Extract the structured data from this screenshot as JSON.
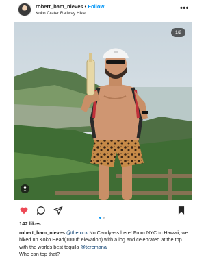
{
  "post": {
    "username": "robert_bam_nieves",
    "separator": "•",
    "follow_label": "Follow",
    "location": "Koko Crater Railway Hike",
    "more_icon": "more-icon",
    "more_glyph": "•••",
    "image_counter": "1/2",
    "likes": "142 likes",
    "caption": {
      "username": "robert_bam_nieves",
      "mention1": "@therock",
      "text1": " No Candyass here! From NYC to Hawaii, we hiked up Koko Head(1000ft elevation) with a log and celebrated  at the top with the worlds best tequila ",
      "mention2": "@teremana",
      "text2": "Who can top that?"
    }
  },
  "icons": {
    "like": "heart-icon",
    "comment": "comment-icon",
    "share": "share-icon",
    "save": "bookmark-icon",
    "tag": "person-tag-icon"
  },
  "colors": {
    "like_red": "#ed4956",
    "link_blue": "#0095f6",
    "mention_blue": "#00376b"
  }
}
